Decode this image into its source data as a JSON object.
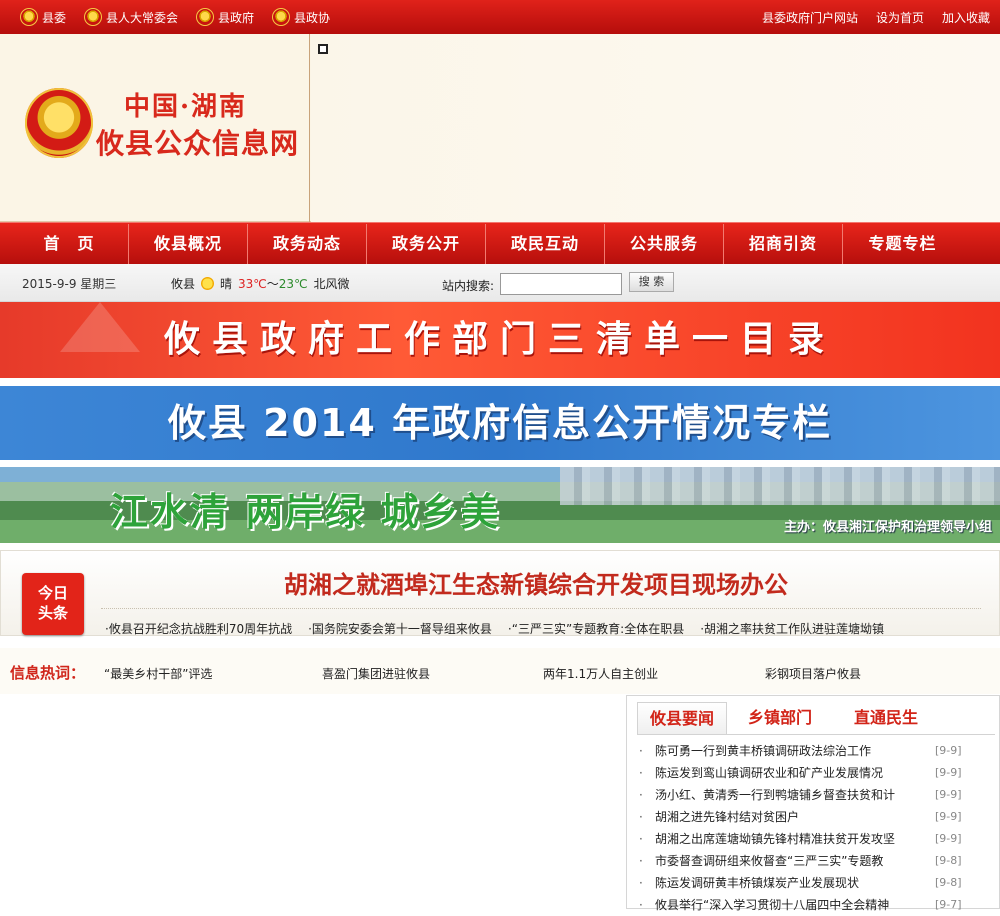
{
  "topbar": {
    "links": [
      "县委",
      "县人大常委会",
      "县政府",
      "县政协"
    ],
    "right": [
      "县委政府门户网站",
      "设为首页",
      "加入收藏"
    ]
  },
  "header": {
    "logo_line1": "中国·湖南",
    "logo_line2": "攸县公众信息网"
  },
  "nav": [
    "首　页",
    "攸县概况",
    "政务动态",
    "政务公开",
    "政民互动",
    "公共服务",
    "招商引资",
    "专题专栏"
  ],
  "infobar": {
    "date": "2015-9-9  星期三",
    "city": "攸县",
    "weather": "晴",
    "temp_high": "33℃",
    "temp_sep": "～",
    "temp_low": "23℃",
    "wind": "北风微",
    "search_label": "站内搜索:",
    "search_button": "搜 索"
  },
  "banners": {
    "b1": "攸县政府工作部门三清单一目录",
    "b2": "攸县 2014 年政府信息公开情况专栏",
    "b3": "江水清 两岸绿 城乡美",
    "b3_sub": "主办：攸县湘江保护和治理领导小组"
  },
  "headline": {
    "badge_line1": "今日",
    "badge_line2": "头条",
    "title": "胡湘之就酒埠江生态新镇综合开发项目现场办公",
    "items": [
      "·攸县召开纪念抗战胜利70周年抗战",
      "·国务院安委会第十一督导组来攸县",
      "·“三严三实”专题教育:全体在职县",
      "·胡湘之率扶贫工作队进驻莲塘坳镇"
    ]
  },
  "hot": {
    "label": "信息热词：",
    "items": [
      "“最美乡村干部”评选",
      "喜盈门集团进驻攸县",
      "两年1.1万人自主创业",
      "彩钢项目落户攸县"
    ]
  },
  "news": {
    "tabs": [
      "攸县要闻",
      "乡镇部门",
      "直通民生"
    ],
    "items": [
      {
        "title": "陈可勇一行到黄丰桥镇调研政法综治工作",
        "date": "[9-9]"
      },
      {
        "title": "陈运发到鸾山镇调研农业和矿产业发展情况",
        "date": "[9-9]"
      },
      {
        "title": "汤小红、黄清秀一行到鸭塘铺乡督查扶贫和计",
        "date": "[9-9]"
      },
      {
        "title": "胡湘之进先锋村结对贫困户",
        "date": "[9-9]"
      },
      {
        "title": "胡湘之出席莲塘坳镇先锋村精准扶贫开发攻坚",
        "date": "[9-9]"
      },
      {
        "title": "市委督查调研组来攸督查“三严三实”专题教",
        "date": "[9-8]"
      },
      {
        "title": "陈运发调研黄丰桥镇煤炭产业发展现状",
        "date": "[9-8]"
      },
      {
        "title": "攸县举行“深入学习贯彻十八届四中全会精神",
        "date": "[9-7]"
      }
    ]
  }
}
